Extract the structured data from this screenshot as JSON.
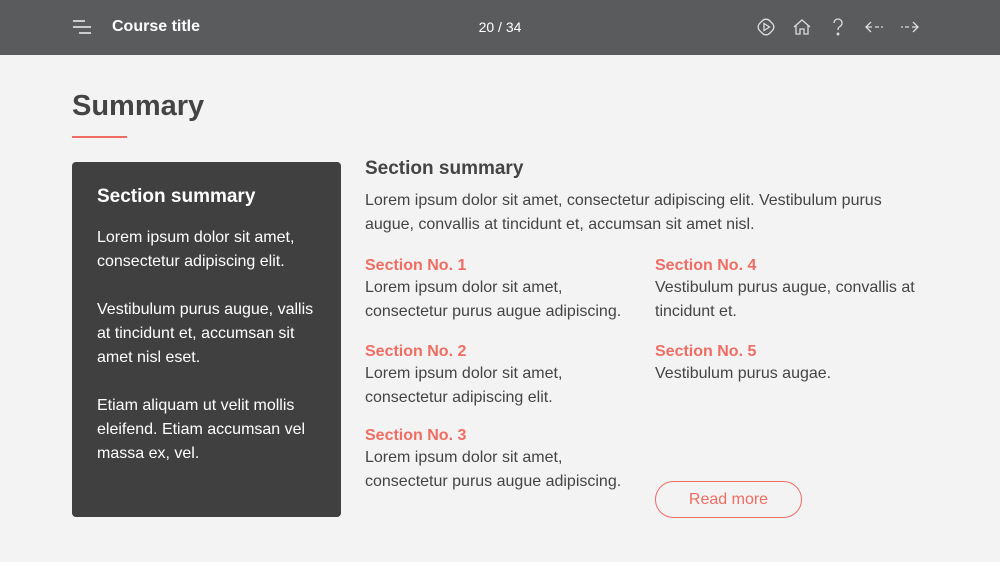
{
  "header": {
    "title": "Course title",
    "page": "20 / 34",
    "icons": [
      "menu-icon",
      "play-icon",
      "home-icon",
      "help-icon",
      "arrow-left-icon",
      "arrow-right-icon"
    ]
  },
  "page_title": "Summary",
  "card": {
    "title": "Section summary",
    "paragraphs": [
      "Lorem ipsum dolor sit amet, consectetur adipiscing elit.",
      "Vestibulum purus augue, vallis at tincidunt et, accumsan sit amet nisl eset.",
      "Etiam aliquam ut velit mollis eleifend. Etiam accumsan vel massa ex, vel."
    ]
  },
  "main": {
    "title": "Section summary",
    "intro": "Lorem ipsum dolor sit amet, consectetur adipiscing elit. Vestibulum purus augue, convallis at tincidunt et, accumsan sit amet nisl.",
    "sections": [
      {
        "title": "Section No. 1",
        "text": "Lorem ipsum dolor sit amet, consectetur purus augue adipiscing."
      },
      {
        "title": "Section No. 2",
        "text": "Lorem ipsum dolor sit amet, consectetur adipiscing elit."
      },
      {
        "title": "Section No. 3",
        "text": "Lorem ipsum dolor sit amet, consectetur purus augue adipiscing."
      },
      {
        "title": "Section No. 4",
        "text": "Vestibulum purus augue, convallis at tincidunt et."
      },
      {
        "title": "Section No. 5",
        "text": "Vestibulum purus augae."
      }
    ],
    "read_more": "Read more"
  },
  "colors": {
    "accent": "#ef6d63",
    "header": "#5a5b5d",
    "card": "#404040"
  }
}
